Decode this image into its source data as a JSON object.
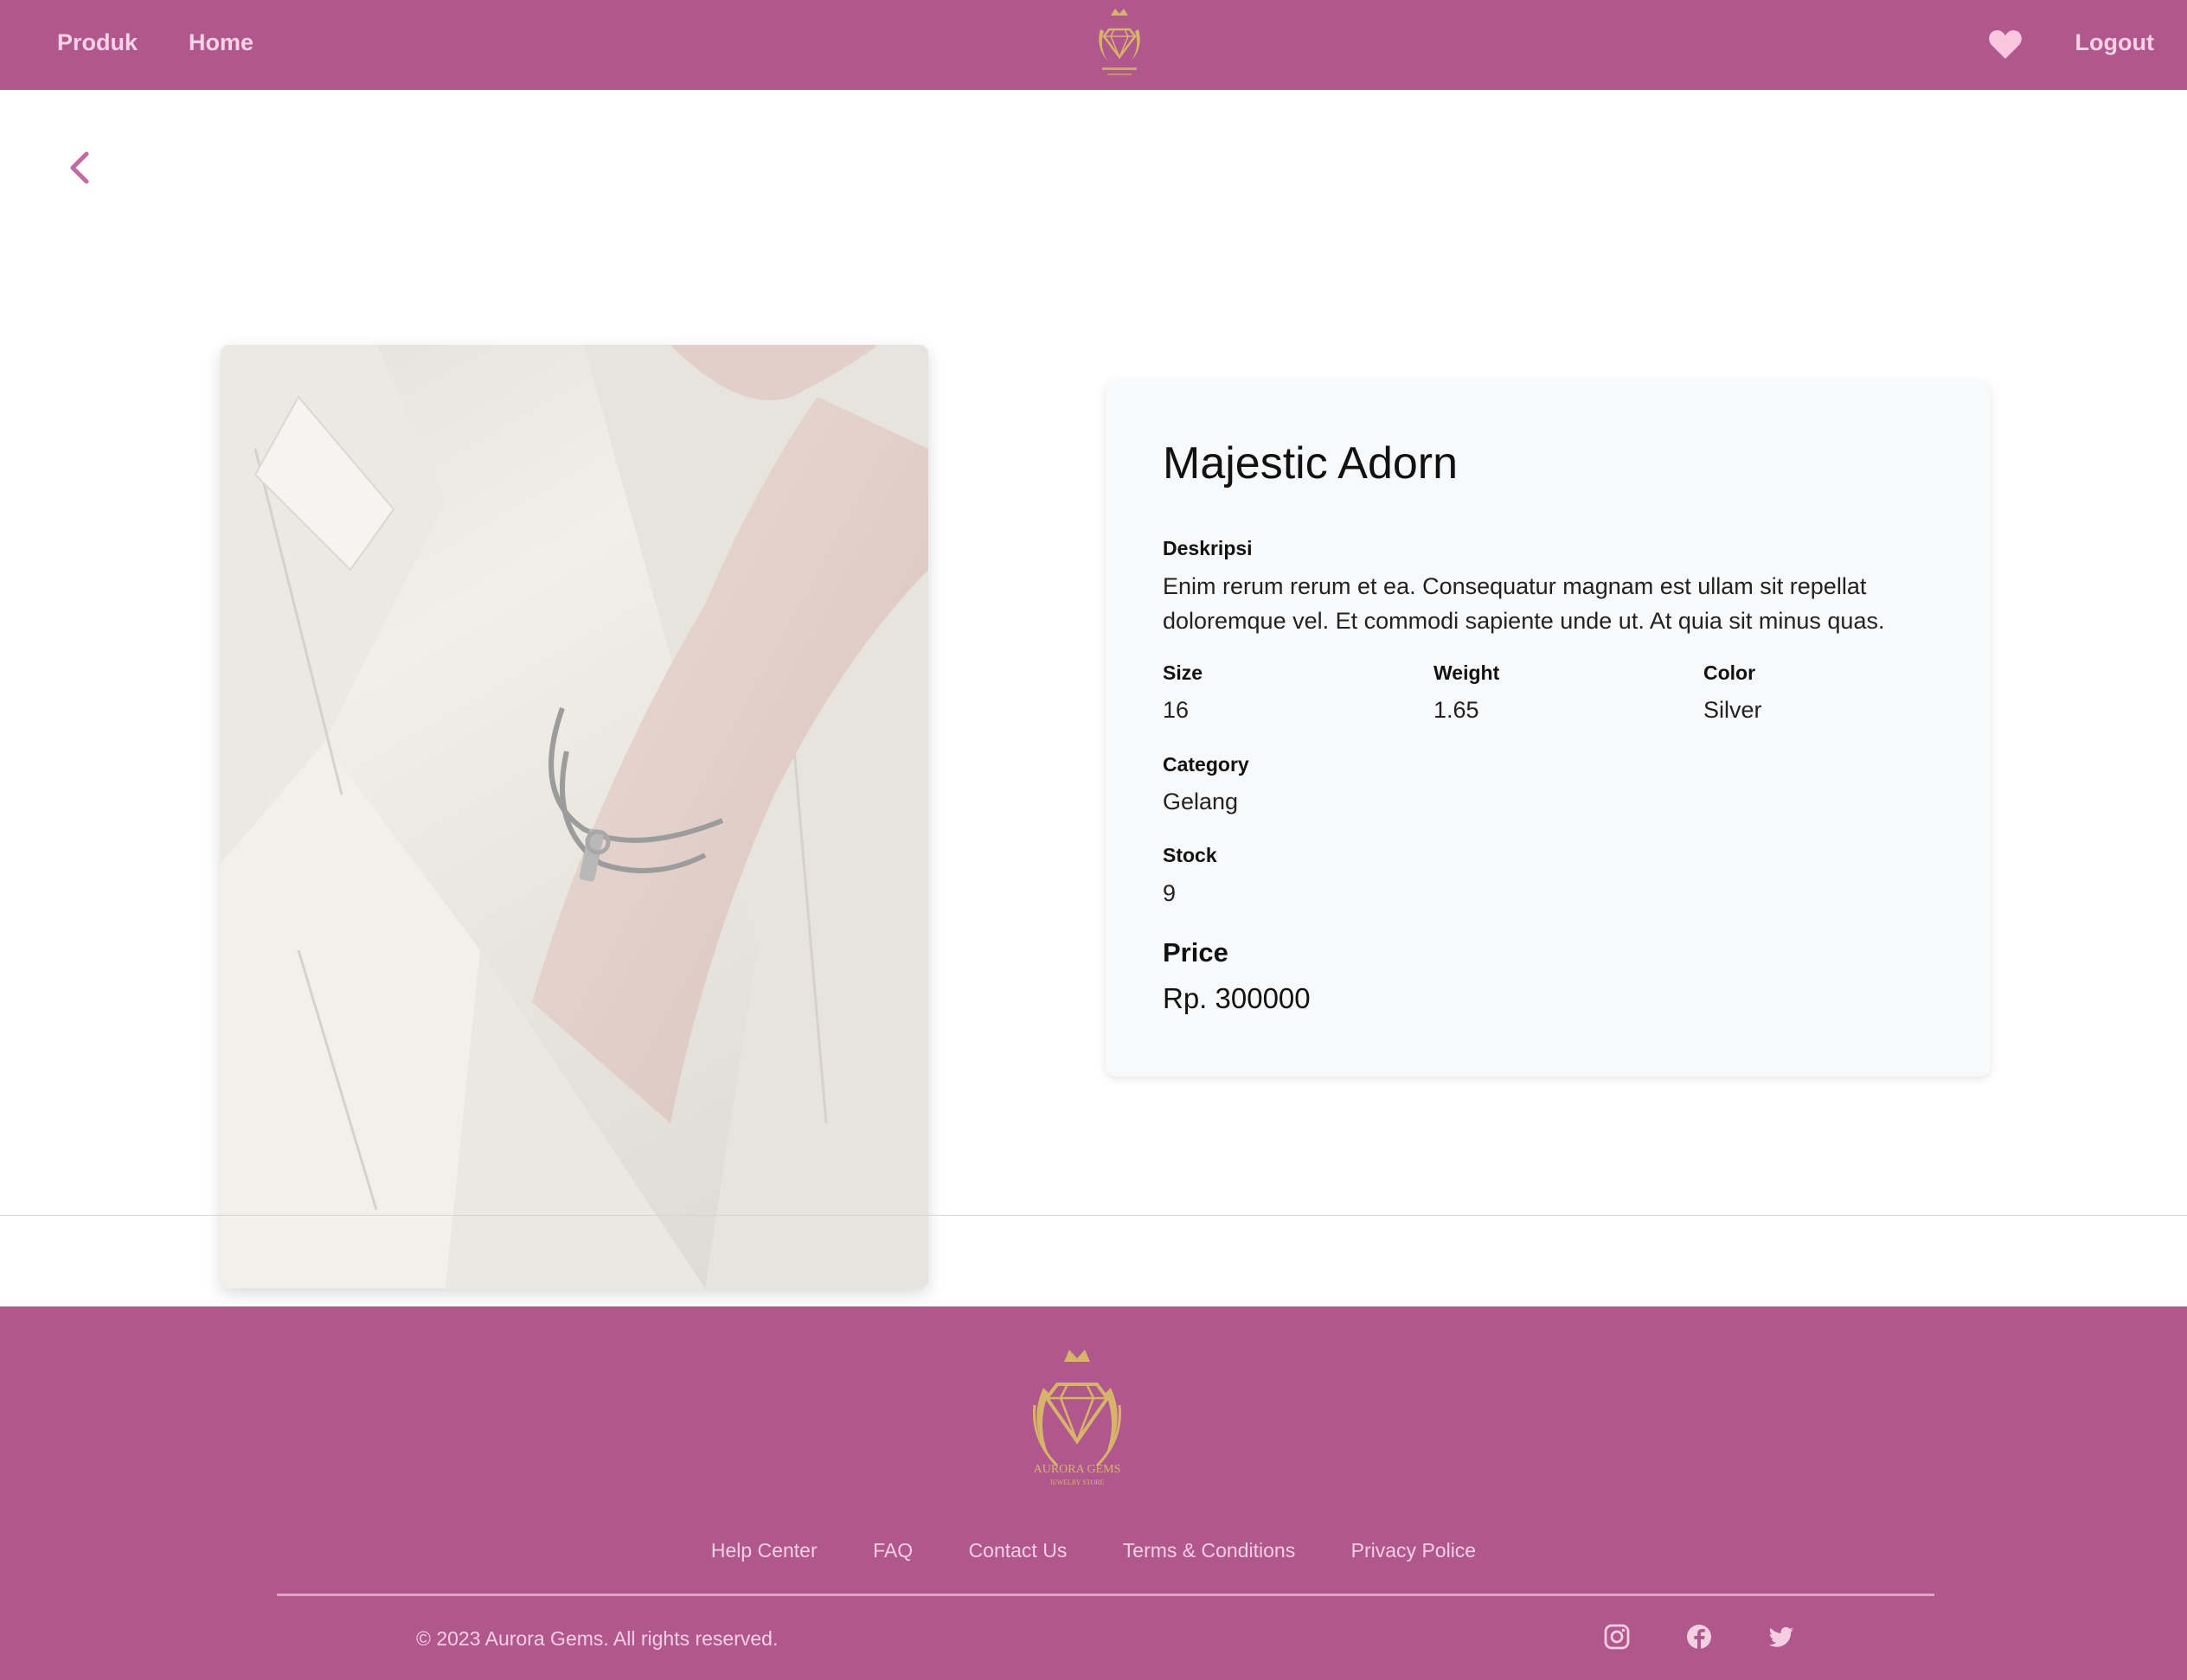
{
  "nav": {
    "produk_label": "Produk",
    "home_label": "Home",
    "logout_label": "Logout",
    "heart_icon": "heart-icon",
    "logo_icon": "aurora-gems-logo"
  },
  "back": {
    "icon": "chevron-left-icon"
  },
  "product": {
    "name": "Majestic Adorn",
    "description_label": "Deskripsi",
    "description": "Enim rerum rerum et ea. Consequatur magnam est ullam sit repellat doloremque vel. Et commodi sapiente unde ut. At quia sit minus quas.",
    "size_label": "Size",
    "size": "16",
    "weight_label": "Weight",
    "weight": "1.65",
    "color_label": "Color",
    "color": "Silver",
    "category_label": "Category",
    "category": "Gelang",
    "stock_label": "Stock",
    "stock": "9",
    "price_label": "Price",
    "price": "Rp. 300000"
  },
  "footer": {
    "logo_text": "AURORA GEMS",
    "logo_subtext": "JEWELRY STORE",
    "links": [
      "Help Center",
      "FAQ",
      "Contact Us",
      "Terms & Conditions",
      "Privacy Police"
    ],
    "copyright": "© 2023 Aurora Gems. All rights reserved.",
    "social": [
      "instagram-icon",
      "facebook-icon",
      "twitter-icon"
    ]
  },
  "colors": {
    "brand": "#b0578d",
    "nav_text": "#f9d2e6",
    "gold": "#d8b46a",
    "card_bg": "#f8f9fa"
  }
}
